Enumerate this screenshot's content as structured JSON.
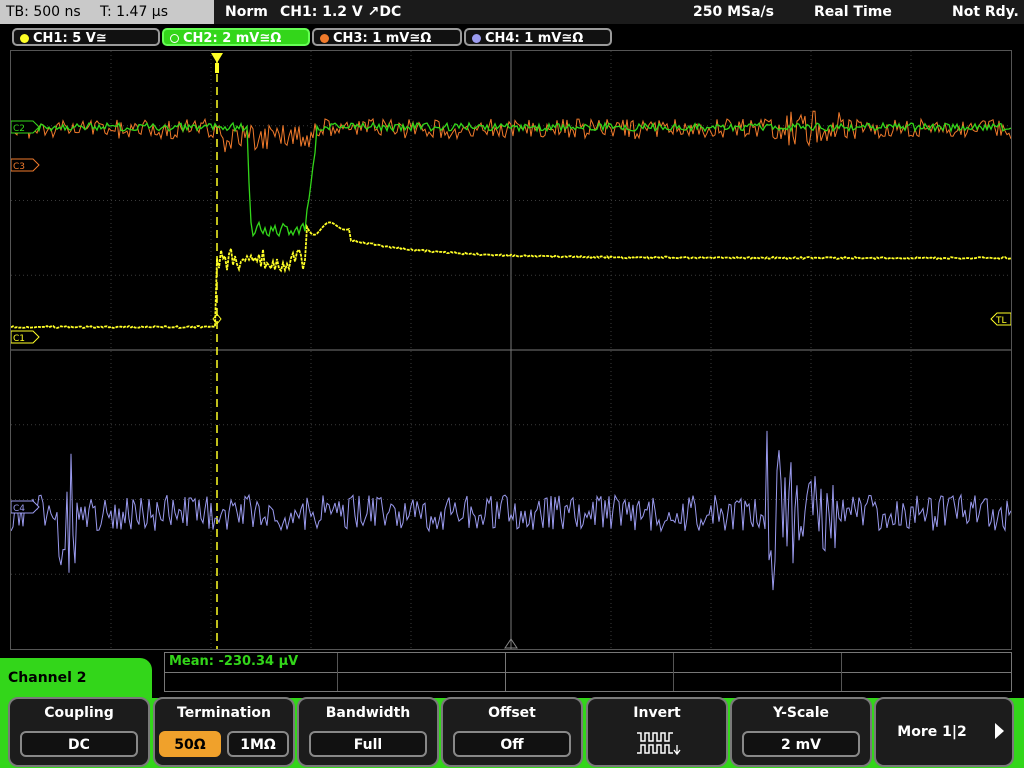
{
  "topbar": {
    "timebase": "TB: 500 ns",
    "trigger_time": "T: 1.47 µs",
    "mode": "Norm",
    "trigger_setting": "CH1: 1.2 V ↗DC",
    "sample_rate": "250 MSa/s",
    "acq_mode": "Real Time",
    "status": "Not Rdy."
  },
  "channels": [
    {
      "label": "CH1: 5 V≅",
      "color": "#ffff26",
      "active": false
    },
    {
      "label": "CH2: 2 mV≅Ω",
      "color": "#33d61a",
      "active": true
    },
    {
      "label": "CH3: 1 mV≅Ω",
      "color": "#f07a2b",
      "active": false
    },
    {
      "label": "CH4: 1 mV≅Ω",
      "color": "#9a9aee",
      "active": false
    }
  ],
  "markers": {
    "c3": "C3",
    "c1": "C1",
    "c2": "C2",
    "c4": "C4",
    "tl": "TL"
  },
  "measurement": {
    "label": "Mean: -230.34 µV"
  },
  "menu": {
    "title": "Channel 2",
    "coupling": {
      "title": "Coupling",
      "value": "DC"
    },
    "termination": {
      "title": "Termination",
      "opt1": "50Ω",
      "opt2": "1MΩ",
      "selected": "50Ω"
    },
    "bandwidth": {
      "title": "Bandwidth",
      "value": "Full"
    },
    "offset": {
      "title": "Offset",
      "value": "Off"
    },
    "invert": {
      "title": "Invert",
      "icon": "inverted-square-wave-icon"
    },
    "yscale": {
      "title": "Y-Scale",
      "value": "2 mV"
    },
    "more": {
      "label": "More 1|2"
    }
  }
}
